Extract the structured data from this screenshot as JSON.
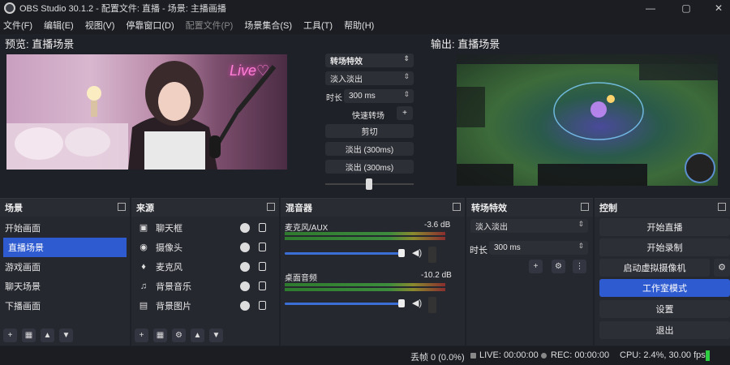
{
  "window": {
    "title": "OBS Studio 30.1.2 - 配置文件: 直播 - 场景: 主播画播",
    "min": "—",
    "max": "▢",
    "close": "✕"
  },
  "menu": [
    "文件(F)",
    "编辑(E)",
    "视图(V)",
    "停靠窗口(D)",
    "配置文件(P)",
    "场景集合(S)",
    "工具(T)",
    "帮助(H)"
  ],
  "preview": {
    "label": "预览: 直播场景",
    "neon": "Live♡"
  },
  "program": {
    "label": "输出: 直播场景"
  },
  "transition_center": {
    "header": "转场特效",
    "type": "淡入淡出",
    "duration_label": "时长",
    "duration": "300 ms",
    "quick_label": "快速转场",
    "plus": "+",
    "buttons": [
      "剪切",
      "淡出 (300ms)",
      "淡出 (300ms)"
    ]
  },
  "scenes": {
    "header": "场景",
    "items": [
      "开始画面",
      "直播场景",
      "游戏画面",
      "聊天场景",
      "下播画面"
    ],
    "active_index": 1
  },
  "sources": {
    "header": "来源",
    "items": [
      {
        "label": "聊天框",
        "icon": "chat-icon"
      },
      {
        "label": "摄像头",
        "icon": "camera-icon"
      },
      {
        "label": "麦克风",
        "icon": "mic-icon"
      },
      {
        "label": "背景音乐",
        "icon": "music-icon"
      },
      {
        "label": "背景图片",
        "icon": "image-icon"
      }
    ]
  },
  "mixer": {
    "header": "混音器",
    "channels": [
      {
        "name": "麦克风/AUX",
        "db": "-3.6 dB",
        "level": 0.82
      },
      {
        "name": "桌面音频",
        "db": "-10.2 dB",
        "level": 0.72
      }
    ]
  },
  "transitions": {
    "header": "转场特效",
    "type": "淡入淡出",
    "duration_label": "时长",
    "duration": "300 ms"
  },
  "controls": {
    "header": "控制",
    "buttons": [
      "开始直播",
      "开始录制",
      "启动虚拟摄像机",
      "工作室模式",
      "设置",
      "退出"
    ]
  },
  "status": {
    "dropped": "丢帧 0 (0.0%)",
    "live": "LIVE: 00:00:00",
    "rec": "REC: 00:00:00",
    "cpu": "CPU: 2.4%, 30.00 fps"
  },
  "colors": {
    "accent": "#2f5bd0",
    "bg": "#1f2128",
    "panel": "#262830",
    "ok": "#2ecc40"
  }
}
